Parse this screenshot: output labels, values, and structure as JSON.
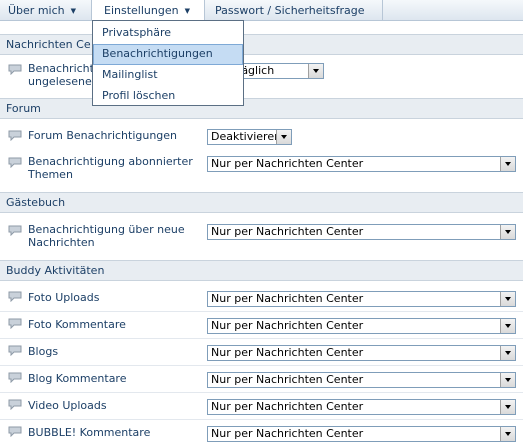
{
  "tabs": [
    {
      "label": "Über mich"
    },
    {
      "label": "Einstellungen"
    },
    {
      "label": "Passwort / Sicherheitsfrage"
    }
  ],
  "menu": {
    "items": [
      "Privatsphäre",
      "Benachrichtigungen",
      "Mailinglist",
      "Profil löschen"
    ],
    "selected": "Benachrichtigungen"
  },
  "sections": {
    "nachrichten": {
      "title": "Nachrichten Ce",
      "rows": [
        {
          "label_line1": "Benachricht",
          "label_line2": "ungelesene",
          "value": "täglich"
        }
      ]
    },
    "forum": {
      "title": "Forum",
      "rows": [
        {
          "label": "Forum Benachrichtigungen",
          "value": "Deaktivieren"
        },
        {
          "label": "Benachrichtigung abonnierter Themen",
          "value": "Nur per Nachrichten Center"
        }
      ]
    },
    "gaestebuch": {
      "title": "Gästebuch",
      "rows": [
        {
          "label": "Benachrichtigung über neue Nachrichten",
          "value": "Nur per Nachrichten Center"
        }
      ]
    },
    "buddy": {
      "title": "Buddy Aktivitäten",
      "rows": [
        {
          "label": "Foto Uploads",
          "value": "Nur per Nachrichten Center"
        },
        {
          "label": "Foto Kommentare",
          "value": "Nur per Nachrichten Center"
        },
        {
          "label": "Blogs",
          "value": "Nur per Nachrichten Center"
        },
        {
          "label": "Blog Kommentare",
          "value": "Nur per Nachrichten Center"
        },
        {
          "label": "Video Uploads",
          "value": "Nur per Nachrichten Center"
        },
        {
          "label": "BUBBLE! Kommentare",
          "value": "Nur per Nachrichten Center"
        }
      ]
    }
  },
  "icons": {
    "row_icon": "speech-bubble-icon"
  },
  "colors": {
    "header_bg": "#e8edf2",
    "text": "#1c3f66",
    "menu_selected": "#c5dcf3"
  }
}
